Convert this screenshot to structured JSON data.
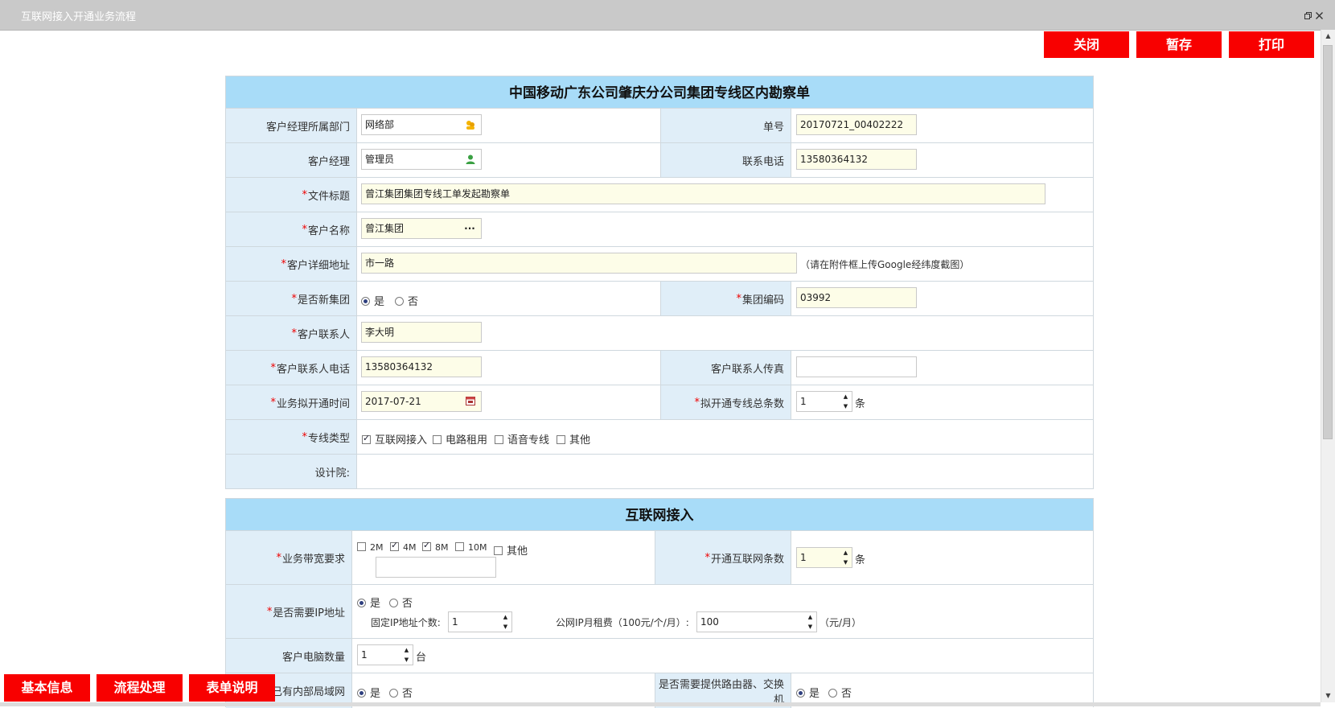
{
  "window": {
    "title": "互联网接入开通业务流程",
    "restore_icon": "restore-icon",
    "close_icon": "close-icon"
  },
  "toolbar": {
    "close_label": "关闭",
    "save_label": "暂存",
    "print_label": "打印"
  },
  "section1": {
    "title": "中国移动广东公司肇庆分公司集团专线区内勘察单",
    "dept_label": "客户经理所属部门",
    "dept_value": "网络部",
    "order_label": "单号",
    "order_value": "20170721_00402222",
    "manager_label": "客户经理",
    "manager_value": "管理员",
    "phone_label": "联系电话",
    "phone_value": "13580364132",
    "doc_title_label": "文件标题",
    "doc_title_value": "曾江集团集团专线工单发起勘察单",
    "customer_name_label": "客户名称",
    "customer_name_value": "曾江集团",
    "customer_name_more": "···",
    "address_label": "客户详细地址",
    "address_value": "市一路",
    "address_hint": "（请在附件框上传Google经纬度截图）",
    "new_group_label": "是否新集团",
    "yes": "是",
    "no": "否",
    "group_code_label": "集团编码",
    "group_code_value": "03992",
    "contact_label": "客户联系人",
    "contact_value": "李大明",
    "contact_phone_label": "客户联系人电话",
    "contact_phone_value": "13580364132",
    "fax_label": "客户联系人传真",
    "fax_value": "",
    "open_time_label": "业务拟开通时间",
    "open_time_value": "2017-07-21",
    "line_count_label": "拟开通专线总条数",
    "line_count_value": "1",
    "line_unit": "条",
    "line_type_label": "专线类型",
    "line_types": [
      "互联网接入",
      "电路租用",
      "语音专线",
      "其他"
    ],
    "designer_label": "设计院:"
  },
  "section2": {
    "title": "互联网接入",
    "bandwidth_label": "业务带宽要求",
    "bandwidths": [
      "2M",
      "4M",
      "8M",
      "10M",
      "其他"
    ],
    "net_count_label": "开通互联网条数",
    "net_count_value": "1",
    "net_unit": "条",
    "need_ip_label": "是否需要IP地址",
    "yes": "是",
    "no": "否",
    "fixed_ip_label": "固定IP地址个数:",
    "fixed_ip_value": "1",
    "ip_rent_label": "公网IP月租费（100元/个/月）:",
    "ip_rent_value": "100",
    "ip_rent_unit": "（元/月）",
    "pc_count_label": "客户电脑数量",
    "pc_count_value": "1",
    "pc_unit": "台",
    "lan_label": "是否已有内部局域网",
    "router_label": "是否需要提供路由器、交换机"
  },
  "bottom_tabs": {
    "basic_info": "基本信息",
    "process": "流程处理",
    "form_note": "表单说明"
  }
}
